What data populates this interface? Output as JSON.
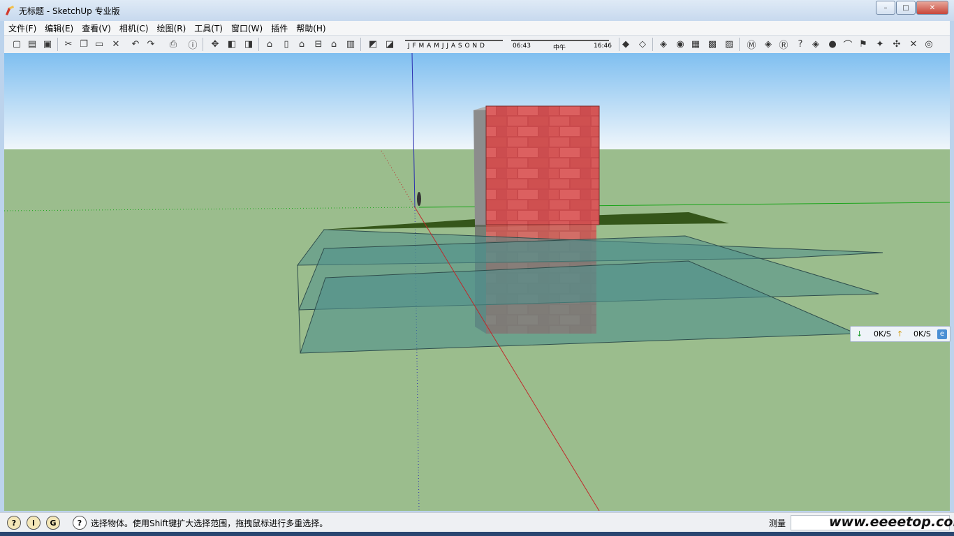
{
  "window": {
    "title": "无标题 - SketchUp 专业版",
    "controls": {
      "minimize": "–",
      "maximize": "□",
      "close": "✕"
    }
  },
  "menu": [
    {
      "label": "文件(F)"
    },
    {
      "label": "编辑(E)"
    },
    {
      "label": "查看(V)"
    },
    {
      "label": "相机(C)"
    },
    {
      "label": "绘图(R)"
    },
    {
      "label": "工具(T)"
    },
    {
      "label": "窗口(W)"
    },
    {
      "label": "插件"
    },
    {
      "label": "帮助(H)"
    }
  ],
  "toolbar": {
    "icons": [
      "new-file",
      "open-file",
      "save",
      "cut",
      "copy",
      "paste",
      "erase",
      "undo",
      "redo",
      "print",
      "model-info",
      "orbit",
      "component",
      "paint",
      "iso-view",
      "top-view",
      "front-view",
      "right-view",
      "back-view",
      "left-view",
      "shadows-toggle",
      "fog-toggle"
    ],
    "shadow_months": "J F M A M J J A S O N D",
    "shadow_time_start": "06:43",
    "shadow_time_noon": "中午",
    "shadow_time_end": "16:46"
  },
  "viewport": {
    "sky_color": "#97c9f1",
    "ground_color": "#9bbd8d",
    "brick_color": "#c94a4c",
    "water_color": "#4f8f8c",
    "axis_red": "#c0282a",
    "axis_green": "#1aa51a",
    "axis_blue": "#2b2fb0"
  },
  "net_monitor": {
    "download": "0K/S",
    "upload": "0K/S"
  },
  "statusbar": {
    "message": "选择物体。使用Shift键扩大选择范围，拖拽鼠标进行多重选择。",
    "measure_label": "测量",
    "measure_value": ""
  },
  "watermark": "www.eeeetop.com"
}
